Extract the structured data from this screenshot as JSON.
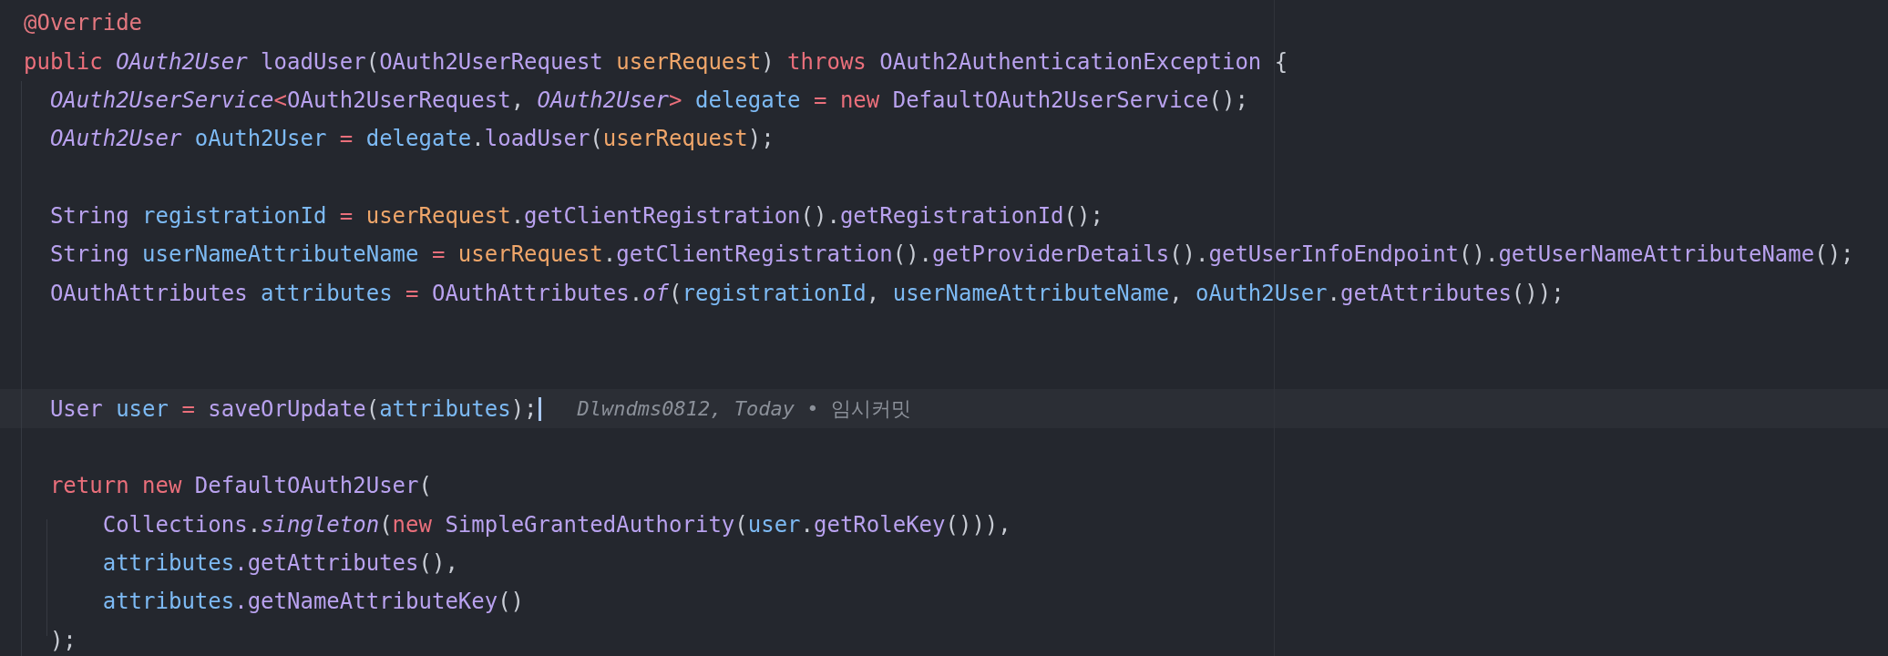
{
  "editor": {
    "lines": [
      {
        "current": false,
        "tokens": [
          {
            "text": "@Override",
            "kind": "annotation"
          }
        ]
      },
      {
        "current": false,
        "tokens": [
          {
            "text": "public ",
            "kind": "keyword"
          },
          {
            "text": "OAuth2User ",
            "kind": "interface"
          },
          {
            "text": "loadUser",
            "kind": "method"
          },
          {
            "text": "(",
            "kind": "plain"
          },
          {
            "text": "OAuth2UserRequest ",
            "kind": "type"
          },
          {
            "text": "userRequest",
            "kind": "param"
          },
          {
            "text": ") ",
            "kind": "plain"
          },
          {
            "text": "throws ",
            "kind": "keyword"
          },
          {
            "text": "OAuth2AuthenticationException",
            "kind": "type"
          },
          {
            "text": " {",
            "kind": "plain"
          }
        ]
      },
      {
        "current": false,
        "tokens": [
          {
            "text": "  OAuth2UserService",
            "kind": "interface"
          },
          {
            "text": "<",
            "kind": "keyword"
          },
          {
            "text": "OAuth2UserRequest",
            "kind": "type"
          },
          {
            "text": ", ",
            "kind": "plain"
          },
          {
            "text": "OAuth2User",
            "kind": "interface"
          },
          {
            "text": "> ",
            "kind": "keyword"
          },
          {
            "text": "delegate ",
            "kind": "variable"
          },
          {
            "text": "= ",
            "kind": "keyword"
          },
          {
            "text": "new ",
            "kind": "keyword"
          },
          {
            "text": "DefaultOAuth2UserService",
            "kind": "type"
          },
          {
            "text": "();",
            "kind": "plain"
          }
        ]
      },
      {
        "current": false,
        "tokens": [
          {
            "text": "  OAuth2User ",
            "kind": "interface"
          },
          {
            "text": "oAuth2User ",
            "kind": "variable"
          },
          {
            "text": "= ",
            "kind": "keyword"
          },
          {
            "text": "delegate",
            "kind": "variable"
          },
          {
            "text": ".",
            "kind": "plain"
          },
          {
            "text": "loadUser",
            "kind": "method"
          },
          {
            "text": "(",
            "kind": "plain"
          },
          {
            "text": "userRequest",
            "kind": "param"
          },
          {
            "text": ");",
            "kind": "plain"
          }
        ]
      },
      {
        "current": false
      },
      {
        "current": false,
        "tokens": [
          {
            "text": "  String ",
            "kind": "type"
          },
          {
            "text": "registrationId ",
            "kind": "variable"
          },
          {
            "text": "= ",
            "kind": "keyword"
          },
          {
            "text": "userRequest",
            "kind": "param"
          },
          {
            "text": ".",
            "kind": "plain"
          },
          {
            "text": "getClientRegistration",
            "kind": "method"
          },
          {
            "text": "().",
            "kind": "plain"
          },
          {
            "text": "getRegistrationId",
            "kind": "method"
          },
          {
            "text": "();",
            "kind": "plain"
          }
        ]
      },
      {
        "current": false,
        "tokens": [
          {
            "text": "  String ",
            "kind": "type"
          },
          {
            "text": "userNameAttributeName ",
            "kind": "variable"
          },
          {
            "text": "= ",
            "kind": "keyword"
          },
          {
            "text": "userRequest",
            "kind": "param"
          },
          {
            "text": ".",
            "kind": "plain"
          },
          {
            "text": "getClientRegistration",
            "kind": "method"
          },
          {
            "text": "().",
            "kind": "plain"
          },
          {
            "text": "getProviderDetails",
            "kind": "method"
          },
          {
            "text": "().",
            "kind": "plain"
          },
          {
            "text": "getUserInfoEndpoint",
            "kind": "method"
          },
          {
            "text": "().",
            "kind": "plain"
          },
          {
            "text": "getUserNameAttributeName",
            "kind": "method"
          },
          {
            "text": "();",
            "kind": "plain"
          }
        ]
      },
      {
        "current": false,
        "tokens": [
          {
            "text": "  OAuthAttributes ",
            "kind": "type"
          },
          {
            "text": "attributes ",
            "kind": "variable"
          },
          {
            "text": "= ",
            "kind": "keyword"
          },
          {
            "text": "OAuthAttributes",
            "kind": "type"
          },
          {
            "text": ".",
            "kind": "plain"
          },
          {
            "text": "of",
            "kind": "static-method"
          },
          {
            "text": "(",
            "kind": "plain"
          },
          {
            "text": "registrationId",
            "kind": "variable"
          },
          {
            "text": ", ",
            "kind": "plain"
          },
          {
            "text": "userNameAttributeName",
            "kind": "variable"
          },
          {
            "text": ", ",
            "kind": "plain"
          },
          {
            "text": "oAuth2User",
            "kind": "variable"
          },
          {
            "text": ".",
            "kind": "plain"
          },
          {
            "text": "getAttributes",
            "kind": "method"
          },
          {
            "text": "());",
            "kind": "plain"
          }
        ]
      },
      {
        "current": false
      },
      {
        "current": false
      },
      {
        "current": true,
        "tokens": [
          {
            "text": "  User ",
            "kind": "type"
          },
          {
            "text": "user ",
            "kind": "variable"
          },
          {
            "text": "= ",
            "kind": "keyword"
          },
          {
            "text": "saveOrUpdate",
            "kind": "method"
          },
          {
            "text": "(",
            "kind": "plain"
          },
          {
            "text": "attributes",
            "kind": "variable"
          },
          {
            "text": ");",
            "kind": "plain"
          }
        ],
        "blame": "*Dlwndms0812, Today* • 임시커밋"
      },
      {
        "current": false
      },
      {
        "current": false,
        "tokens": [
          {
            "text": "  return ",
            "kind": "keyword"
          },
          {
            "text": "new ",
            "kind": "keyword"
          },
          {
            "text": "DefaultOAuth2User",
            "kind": "type"
          },
          {
            "text": "(",
            "kind": "plain"
          }
        ]
      },
      {
        "current": false,
        "tokens": [
          {
            "text": "      Collections",
            "kind": "type"
          },
          {
            "text": ".",
            "kind": "plain"
          },
          {
            "text": "singleton",
            "kind": "static-method"
          },
          {
            "text": "(",
            "kind": "plain"
          },
          {
            "text": "new ",
            "kind": "keyword"
          },
          {
            "text": "SimpleGrantedAuthority",
            "kind": "type"
          },
          {
            "text": "(",
            "kind": "plain"
          },
          {
            "text": "user",
            "kind": "variable"
          },
          {
            "text": ".",
            "kind": "plain"
          },
          {
            "text": "getRoleKey",
            "kind": "method"
          },
          {
            "text": "())),",
            "kind": "plain"
          }
        ]
      },
      {
        "current": false,
        "tokens": [
          {
            "text": "      attributes",
            "kind": "variable"
          },
          {
            "text": ".getAttributes",
            "kind": "method"
          },
          {
            "text": "(),",
            "kind": "plain"
          }
        ]
      },
      {
        "current": false,
        "tokens": [
          {
            "text": "      attributes",
            "kind": "variable"
          },
          {
            "text": ".getNameAttributeKey",
            "kind": "method"
          },
          {
            "text": "()",
            "kind": "plain"
          }
        ]
      },
      {
        "current": false,
        "tokens": [
          {
            "text": "  );",
            "kind": "plain"
          }
        ]
      }
    ]
  }
}
